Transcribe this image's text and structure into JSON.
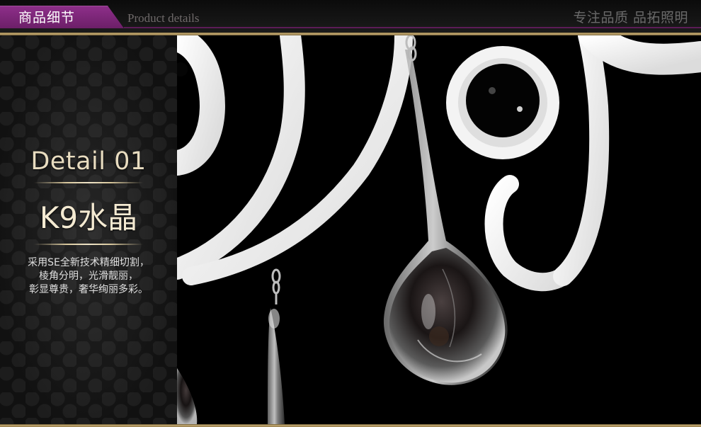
{
  "header": {
    "tab_label": "商品细节",
    "subtitle": "Product details",
    "slogan": "专注品质 品拓照明"
  },
  "left_panel": {
    "detail_title": "Detail 01",
    "product_name": "K9水晶",
    "description_lines": [
      "采用SE全新技术精细切割，",
      "棱角分明，光滑靓丽，",
      "彰显尊贵，奢华绚丽多彩。"
    ]
  },
  "colors": {
    "accent_purple": "#7a2474",
    "gold": "#c9ad74"
  }
}
